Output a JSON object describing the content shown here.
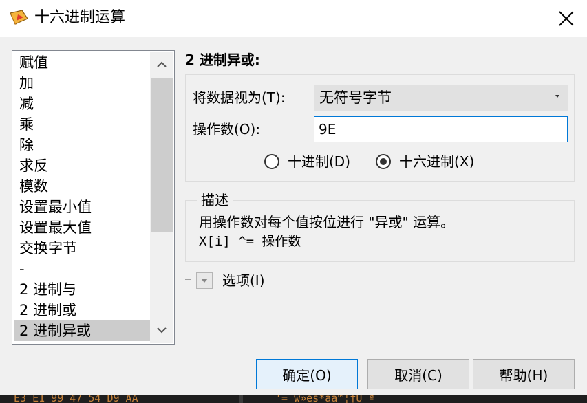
{
  "window": {
    "title": "十六进制运算",
    "close_icon": "close-icon"
  },
  "operations": {
    "items": [
      {
        "label": "赋值"
      },
      {
        "label": "加"
      },
      {
        "label": "减"
      },
      {
        "label": "乘"
      },
      {
        "label": "除"
      },
      {
        "label": "求反"
      },
      {
        "label": "模数"
      },
      {
        "label": "设置最小值"
      },
      {
        "label": "设置最大值"
      },
      {
        "label": "交换字节"
      },
      {
        "label": "-"
      },
      {
        "label": "2 进制与"
      },
      {
        "label": "2 进制或"
      },
      {
        "label": "2 进制异或"
      }
    ],
    "selected": "2 进制异或"
  },
  "panel": {
    "title": "2 进制异或:",
    "data_type_label": "将数据视为(T):",
    "data_type_value": "无符号字节",
    "operand_label": "操作数(O):",
    "operand_value": "9E",
    "radio_decimal": "十进制(D)",
    "radio_hex": "十六进制(X)",
    "radio_selected": "hex"
  },
  "description": {
    "legend": "描述",
    "line1": "用操作数对每个值按位进行 \"异或\" 运算。",
    "line2": "X[i] ^= 操作数"
  },
  "options": {
    "label": "选项(I)"
  },
  "buttons": {
    "ok": "确定(O)",
    "cancel": "取消(C)",
    "help": "帮助(H)"
  },
  "background": {
    "hex_fragment": "E3 E1 99 47 54 D9 AA",
    "ascii_fragment": "'= w»es*aa™¦†Ü ª"
  },
  "colors": {
    "accent": "#0078d7",
    "selection": "#cccccc",
    "dialog_bg": "#f0f0f0"
  }
}
